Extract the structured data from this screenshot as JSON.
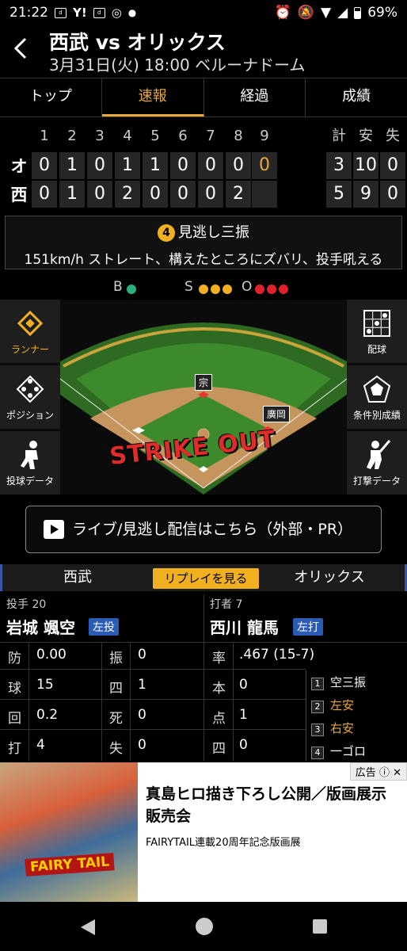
{
  "status": {
    "time": "21:22",
    "battery": "69%",
    "left_icons": [
      "ahlt",
      "Y!",
      "dhlt",
      "pocket",
      "•"
    ]
  },
  "header": {
    "title": "西武 vs オリックス",
    "subtitle": "3月31日(火) 18:00 ベルーナドーム"
  },
  "tabs": [
    "トップ",
    "速報",
    "経過",
    "成績"
  ],
  "active_tab": "速報",
  "scoreboard": {
    "innings": [
      "1",
      "2",
      "3",
      "4",
      "5",
      "6",
      "7",
      "8",
      "9"
    ],
    "total_headers": [
      "計",
      "安",
      "失"
    ],
    "rows": [
      {
        "team": "オ",
        "innings": [
          "0",
          "1",
          "0",
          "1",
          "1",
          "0",
          "0",
          "0",
          "0"
        ],
        "totals": [
          "3",
          "10",
          "0"
        ]
      },
      {
        "team": "西",
        "innings": [
          "0",
          "1",
          "0",
          "2",
          "0",
          "0",
          "0",
          "2",
          ""
        ],
        "totals": [
          "5",
          "9",
          "0"
        ]
      }
    ]
  },
  "play": {
    "number": "4",
    "result": "見逃し三振",
    "description": "151km/h ストレート、構えたところにズバリ、投手吼える"
  },
  "count": {
    "b_label": "B",
    "s_label": "S",
    "o_label": "O",
    "balls": 1,
    "strikes": 3,
    "outs": 3
  },
  "field": {
    "runner_1": "宗",
    "runner_2": "廣岡",
    "banner": "STRIKE OUT"
  },
  "side_left": [
    "ランナー",
    "ポジション",
    "投球データ"
  ],
  "side_right": [
    "配球",
    "条件別成績",
    "打撃データ"
  ],
  "live_button": "ライブ/見逃し配信はこちら（外部・PR）",
  "teambar": {
    "left": "西武",
    "right": "オリックス",
    "replay": "リプレイを見る"
  },
  "pitcher": {
    "label": "投手 20",
    "name": "岩城 颯空",
    "hand": "左投",
    "stats": [
      [
        "防",
        "0.00"
      ],
      [
        "振",
        "0"
      ],
      [
        "球",
        "15"
      ],
      [
        "四",
        "1"
      ],
      [
        "回",
        "0.2"
      ],
      [
        "死",
        "0"
      ],
      [
        "打",
        "4"
      ],
      [
        "失",
        "0"
      ]
    ]
  },
  "batter": {
    "label": "打者 7",
    "name": "西川 龍馬",
    "hand": "左打",
    "stats": [
      [
        "率",
        ".467 (15-7)"
      ],
      [
        "本",
        "0"
      ],
      [
        "点",
        "1"
      ],
      [
        "四",
        "0"
      ]
    ],
    "atbats": [
      {
        "n": "1",
        "result": "空三振",
        "hit": false
      },
      {
        "n": "2",
        "result": "左安",
        "hit": true
      },
      {
        "n": "3",
        "result": "右安",
        "hit": true
      },
      {
        "n": "4",
        "result": "一ゴロ",
        "hit": false
      }
    ]
  },
  "ad": {
    "tag": "広告",
    "title": "真島ヒロ描き下ろし公開／版画展示販売会",
    "subtitle": "FAIRYTAIL連載20周年記念版画展",
    "logo_text": "FAIRY TAIL"
  },
  "colors": {
    "accent": "#e8a93a",
    "ball": "#2ab07a",
    "strike": "#f0b020",
    "out": "#e0202a",
    "hand_badge": "#2a5bb5"
  }
}
